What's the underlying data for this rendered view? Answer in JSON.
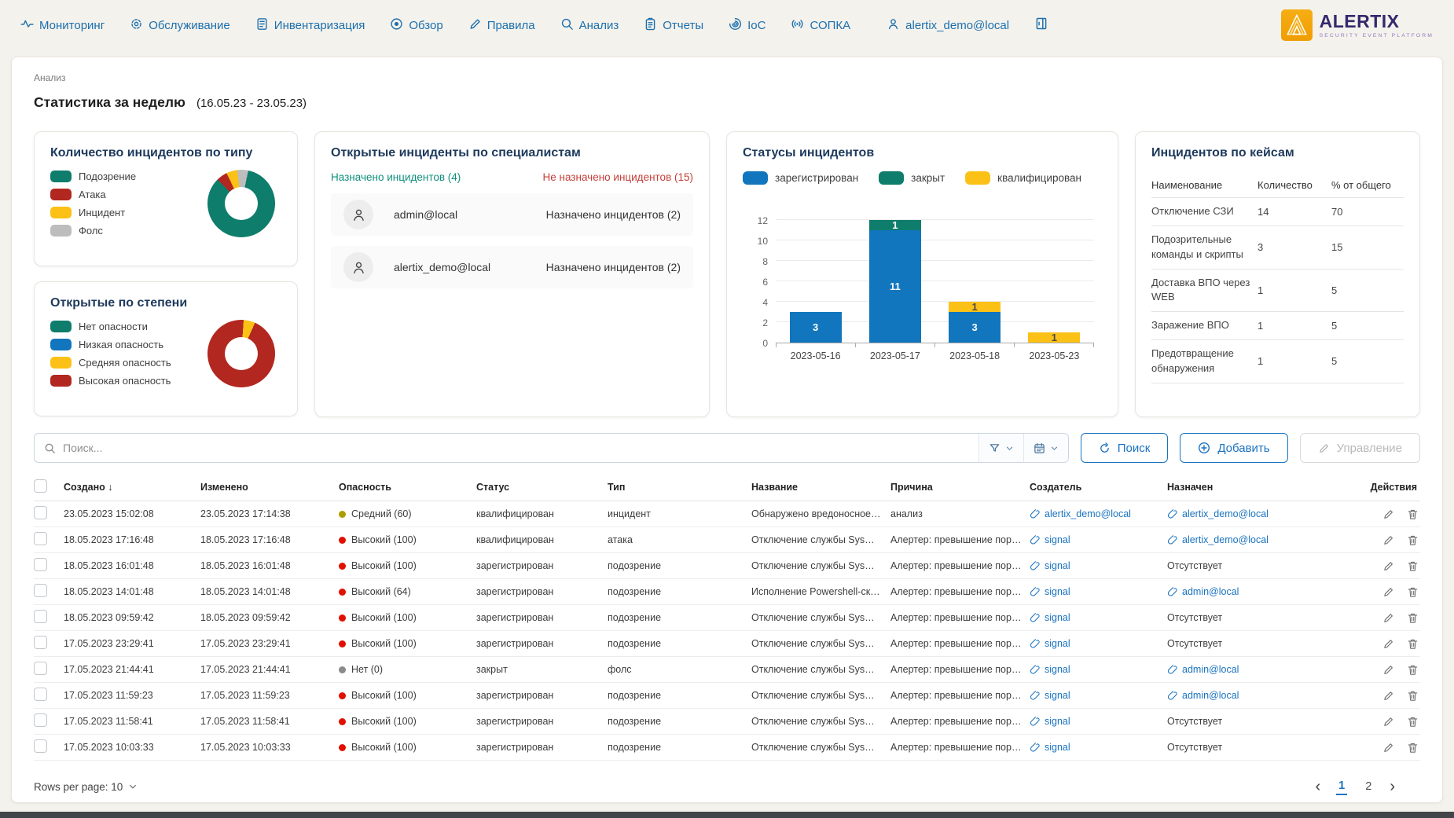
{
  "nav": {
    "items": [
      {
        "label": "Мониторинг"
      },
      {
        "label": "Обслуживание"
      },
      {
        "label": "Инвентаризация"
      },
      {
        "label": "Обзор"
      },
      {
        "label": "Правила"
      },
      {
        "label": "Анализ"
      },
      {
        "label": "Отчеты"
      },
      {
        "label": "IoC"
      },
      {
        "label": "СОПКА"
      },
      {
        "label": "alertix_demo@local"
      }
    ],
    "logo_title": "ALERTIX",
    "logo_subtitle": "SECURITY EVENT PLATFORM"
  },
  "breadcrumb": "Анализ",
  "page_title": "Статистика за неделю",
  "page_period": "(16.05.23 - 23.05.23)",
  "chart_data": [
    {
      "type": "pie",
      "donut": true,
      "title": "Количество инцидентов по типу",
      "labels": [
        "Подозрение",
        "Атака",
        "Инцидент",
        "Фолс"
      ],
      "values": [
        16,
        1,
        1,
        1
      ],
      "colors": [
        "#0e7d6c",
        "#b2271f",
        "#fcc117",
        "#bdbdbd"
      ],
      "legend_position": "left"
    },
    {
      "type": "pie",
      "donut": true,
      "title": "Открытые по степени",
      "labels": [
        "Нет опасности",
        "Низкая опасность",
        "Средняя опасность",
        "Высокая опасность"
      ],
      "values": [
        0,
        0,
        1,
        17
      ],
      "colors": [
        "#0e7d6c",
        "#1176bd",
        "#fcc117",
        "#b2271f"
      ],
      "legend_position": "left"
    },
    {
      "type": "bar",
      "stacked": true,
      "title": "Статусы инцидентов",
      "categories": [
        "2023-05-16",
        "2023-05-17",
        "2023-05-18",
        "2023-05-23"
      ],
      "series": [
        {
          "name": "зарегистрирован",
          "color": "#1176bd",
          "values": [
            3,
            11,
            3,
            0
          ]
        },
        {
          "name": "закрыт",
          "color": "#0e7d6c",
          "values": [
            0,
            1,
            0,
            0
          ]
        },
        {
          "name": "квалифицирован",
          "color": "#fcc117",
          "values": [
            0,
            0,
            1,
            1
          ]
        }
      ],
      "ylim": [
        0,
        12
      ],
      "ytick_step": 2,
      "grid": true,
      "legend_position": "top"
    }
  ],
  "specialists": {
    "title": "Открытые инциденты по специалистам",
    "assigned_label": "Назначено инцидентов (4)",
    "unassigned_label": "Не назначено инцидентов (15)",
    "rows": [
      {
        "user": "admin@local",
        "count_label": "Назначено инцидентов (2)"
      },
      {
        "user": "alertix_demo@local",
        "count_label": "Назначено инцидентов (2)"
      }
    ]
  },
  "cases": {
    "title": "Инцидентов по кейсам",
    "columns": [
      "Наименование",
      "Количество",
      "% от общего"
    ],
    "rows": [
      {
        "name": "Отключение СЗИ",
        "count": "14",
        "percent": "70"
      },
      {
        "name": "Подозрительные команды и скрипты",
        "count": "3",
        "percent": "15"
      },
      {
        "name": "Доставка ВПО через WEB",
        "count": "1",
        "percent": "5"
      },
      {
        "name": "Заражение ВПО",
        "count": "1",
        "percent": "5"
      },
      {
        "name": "Предотвращение обнаружения",
        "count": "1",
        "percent": "5"
      }
    ]
  },
  "toolbar": {
    "search_placeholder": "Поиск...",
    "search_button": "Поиск",
    "add_button": "Добавить",
    "manage_button": "Управление"
  },
  "table": {
    "columns": [
      "Создано",
      "Изменено",
      "Опасность",
      "Статус",
      "Тип",
      "Название",
      "Причина",
      "Создатель",
      "Назначен",
      "Действия"
    ],
    "severity_colors": {
      "Средний": "#ad9c00",
      "Высокий": "#e01000",
      "Нет": "#8a8a8a"
    },
    "rows": [
      {
        "created": "23.05.2023 15:02:08",
        "modified": "23.05.2023 17:14:38",
        "severity": "Средний (60)",
        "sev": "Средний",
        "status": "квалифицирован",
        "type": "инцидент",
        "name": "Обнаружено вредоносное П...",
        "reason": "анализ",
        "creator": "alertix_demo@local",
        "assignee": "alertix_demo@local",
        "assignee_link": true
      },
      {
        "created": "18.05.2023 17:16:48",
        "modified": "18.05.2023 17:16:48",
        "severity": "Высокий (100)",
        "sev": "Высокий",
        "status": "квалифицирован",
        "type": "атака",
        "name": "Отключение службы Sysmon...",
        "reason": "Алертер: превышение порог...",
        "creator": "signal",
        "assignee": "alertix_demo@local",
        "assignee_link": true
      },
      {
        "created": "18.05.2023 16:01:48",
        "modified": "18.05.2023 16:01:48",
        "severity": "Высокий (100)",
        "sev": "Высокий",
        "status": "зарегистрирован",
        "type": "подозрение",
        "name": "Отключение службы Sysmon...",
        "reason": "Алертер: превышение порог...",
        "creator": "signal",
        "assignee": "Отсутствует",
        "assignee_link": false
      },
      {
        "created": "18.05.2023 14:01:48",
        "modified": "18.05.2023 14:01:48",
        "severity": "Высокий (64)",
        "sev": "Высокий",
        "status": "зарегистрирован",
        "type": "подозрение",
        "name": "Исполнение Powershell-скри...",
        "reason": "Алертер: превышение порог...",
        "creator": "signal",
        "assignee": "admin@local",
        "assignee_link": true
      },
      {
        "created": "18.05.2023 09:59:42",
        "modified": "18.05.2023 09:59:42",
        "severity": "Высокий (100)",
        "sev": "Высокий",
        "status": "зарегистрирован",
        "type": "подозрение",
        "name": "Отключение службы Sysmon...",
        "reason": "Алертер: превышение порог...",
        "creator": "signal",
        "assignee": "Отсутствует",
        "assignee_link": false
      },
      {
        "created": "17.05.2023 23:29:41",
        "modified": "17.05.2023 23:29:41",
        "severity": "Высокий (100)",
        "sev": "Высокий",
        "status": "зарегистрирован",
        "type": "подозрение",
        "name": "Отключение службы Sysmon...",
        "reason": "Алертер: превышение порог...",
        "creator": "signal",
        "assignee": "Отсутствует",
        "assignee_link": false
      },
      {
        "created": "17.05.2023 21:44:41",
        "modified": "17.05.2023 21:44:41",
        "severity": "Нет (0)",
        "sev": "Нет",
        "status": "закрыт",
        "type": "фолс",
        "name": "Отключение службы Sysmon...",
        "reason": "Алертер: превышение порог...",
        "creator": "signal",
        "assignee": "admin@local",
        "assignee_link": true
      },
      {
        "created": "17.05.2023 11:59:23",
        "modified": "17.05.2023 11:59:23",
        "severity": "Высокий (100)",
        "sev": "Высокий",
        "status": "зарегистрирован",
        "type": "подозрение",
        "name": "Отключение службы Sysmon...",
        "reason": "Алертер: превышение порог...",
        "creator": "signal",
        "assignee": "admin@local",
        "assignee_link": true
      },
      {
        "created": "17.05.2023 11:58:41",
        "modified": "17.05.2023 11:58:41",
        "severity": "Высокий (100)",
        "sev": "Высокий",
        "status": "зарегистрирован",
        "type": "подозрение",
        "name": "Отключение службы Sysmon...",
        "reason": "Алертер: превышение порог...",
        "creator": "signal",
        "assignee": "Отсутствует",
        "assignee_link": false
      },
      {
        "created": "17.05.2023 10:03:33",
        "modified": "17.05.2023 10:03:33",
        "severity": "Высокий (100)",
        "sev": "Высокий",
        "status": "зарегистрирован",
        "type": "подозрение",
        "name": "Отключение службы Sysmon...",
        "reason": "Алертер: превышение порог...",
        "creator": "signal",
        "assignee": "Отсутствует",
        "assignee_link": false
      }
    ]
  },
  "footer": {
    "rows_per_page": "Rows per page: 10",
    "pages": [
      "1",
      "2"
    ],
    "active_page": "1"
  }
}
